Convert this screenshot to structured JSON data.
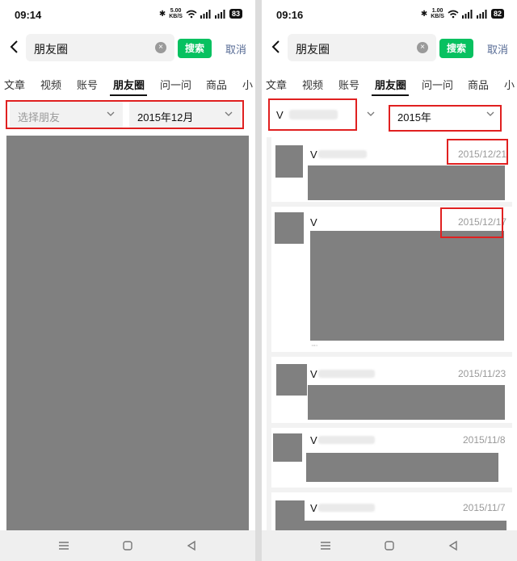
{
  "left": {
    "status": {
      "time": "09:14",
      "speed_value": "5.00",
      "speed_unit": "KB/S",
      "battery": "83"
    },
    "search": {
      "query": "朋友圈",
      "search_label": "搜索",
      "cancel_label": "取消"
    },
    "tabs": [
      "文章",
      "视频",
      "账号",
      "朋友圈",
      "问一问",
      "商品",
      "小"
    ],
    "active_tab": "朋友圈",
    "filter": {
      "friend_placeholder": "选择朋友",
      "date_value": "2015年12月"
    }
  },
  "right": {
    "status": {
      "time": "09:16",
      "speed_value": "1.00",
      "speed_unit": "KB/S",
      "battery": "82"
    },
    "search": {
      "query": "朋友圈",
      "search_label": "搜索",
      "cancel_label": "取消"
    },
    "tabs": [
      "文章",
      "视频",
      "账号",
      "朋友圈",
      "问一问",
      "商品",
      "小"
    ],
    "active_tab": "朋友圈",
    "filter": {
      "friend_value": "V",
      "date_value": "2015年"
    },
    "posts": [
      {
        "name": "V",
        "date": "2015/12/21"
      },
      {
        "name": "V",
        "date": "2015/12/17"
      },
      {
        "name": "V",
        "date": "2015/11/23"
      },
      {
        "name": "V",
        "date": "2015/11/8"
      },
      {
        "name": "V",
        "date": "2015/11/7"
      }
    ]
  },
  "colors": {
    "accent": "#07c160",
    "link": "#576b95",
    "highlight": "#e02020",
    "redacted": "#808080"
  }
}
